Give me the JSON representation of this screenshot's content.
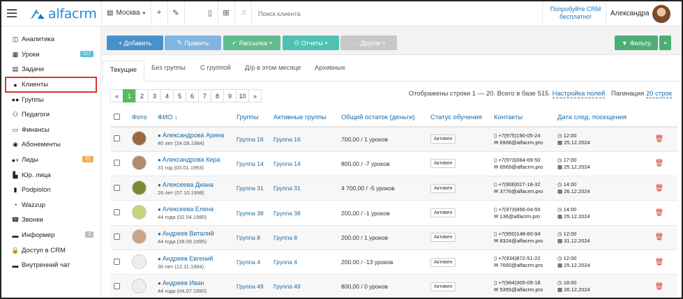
{
  "header": {
    "logo_text": "alfacrm",
    "branch": "Москва",
    "search_placeholder": "Поиск клиента",
    "try_crm": "Попробуйте CRM бесплатно!",
    "user_name": "Александра"
  },
  "sidebar": {
    "items": [
      {
        "label": "Аналитика",
        "icon": "chart-icon"
      },
      {
        "label": "Уроки",
        "icon": "calendar-icon",
        "badge": "117",
        "badge_color": "#5bc0de"
      },
      {
        "label": "Задачи",
        "icon": "clipboard-icon"
      },
      {
        "label": "Клиенты",
        "icon": "user-icon",
        "active": true
      },
      {
        "label": "Группы",
        "icon": "users-icon"
      },
      {
        "label": "Педагоги",
        "icon": "teacher-icon"
      },
      {
        "label": "Финансы",
        "icon": "money-icon"
      },
      {
        "label": "Абонементы",
        "icon": "ticket-icon"
      },
      {
        "label": "Лиды",
        "icon": "add-user-icon",
        "badge": "21",
        "badge_color": "#f0ad4e"
      },
      {
        "label": "Юр. лица",
        "icon": "building-icon"
      },
      {
        "label": "Podpislon",
        "icon": "file-icon"
      },
      {
        "label": "Wazzup",
        "icon": "chat-icon"
      },
      {
        "label": "Звонки",
        "icon": "phone-icon"
      },
      {
        "label": "Информер",
        "icon": "card-icon",
        "badge": "3",
        "badge_color": "#bbbbbb"
      },
      {
        "label": "Доступ в CRM",
        "icon": "lock-icon"
      },
      {
        "label": "Внутренний чат",
        "icon": "message-icon"
      }
    ]
  },
  "toolbar": {
    "add": "+ Добавить",
    "edit": "Править",
    "mailing": "Рассылка",
    "reports": "Отчеты",
    "other": "Другое",
    "filter": "Фильтр",
    "colors": {
      "blue": "#4a90c9",
      "blue_light": "#7fb5e0",
      "green": "#62bb8c",
      "teal": "#4fc1b2",
      "grey": "#c8c8c8",
      "filter_green": "#4cae73"
    }
  },
  "tabs": [
    "Текущие",
    "Без группы",
    "С группой",
    "Д/р в этом месяце",
    "Архивные"
  ],
  "pager": {
    "prev": "«",
    "pages": [
      "1",
      "2",
      "3",
      "4",
      "5",
      "6",
      "7",
      "8",
      "9",
      "10"
    ],
    "next": "»",
    "active": "1"
  },
  "rows_info": {
    "text": "Отображены строки 1 — 20. Всего в базе 515.",
    "fields_link": "Настройка полей",
    "pagination_label": "Пагинация",
    "pagination_value": "20 строк"
  },
  "table": {
    "columns": [
      "Фото",
      "ФИО ↓",
      "Группы",
      "Активные группы",
      "Общий остаток (деньги)",
      "Статус обучения",
      "Контакты",
      "Дата след. посещения"
    ],
    "rows": [
      {
        "name": "Александрова Арина",
        "age": "40 лет (24.08.1984)",
        "group": "Группа 16",
        "active_group": "Группа 16",
        "balance": "700,00 / 1 уроков",
        "status": "Активен",
        "phone": "+7(975)190-05-24",
        "email": "6908@alfacrm.pro",
        "time": "12:00",
        "date": "25.12.2024",
        "photo": "#9a6a3e"
      },
      {
        "name": "Александрова Кира",
        "age": "31 год (03.01.1993)",
        "group": "Группа 14",
        "active_group": "Группа 14",
        "balance": "800,00 / -7 уроков",
        "status": "Активен",
        "phone": "+7(973)084-69-50",
        "email": "6569@alfacrm.pro",
        "time": "17:00",
        "date": "25.12.2024",
        "photo": "#b58a6a"
      },
      {
        "name": "Алексеева Диана",
        "age": "26 лет (07.10.1998)",
        "group": "Группа 31",
        "active_group": "Группа 31",
        "balance": "4 700,00 / -5 уроков",
        "status": "Активен",
        "phone": "+7(906)027-18-32",
        "email": "3776@alfacrm.pro",
        "time": "14:00",
        "date": "26.12.2024",
        "photo": "#7d8a2e"
      },
      {
        "name": "Алексеева Елена",
        "age": "44 года (02.04.1980)",
        "group": "Группа 38",
        "active_group": "Группа 38",
        "balance": "200,00 / -1 уроков",
        "status": "Активен",
        "phone": "+7(973)956-04-55",
        "email": "136@alfacrm.pro",
        "time": "14:00",
        "date": "25.12.2024",
        "photo": "#c9d27a"
      },
      {
        "name": "Андреев Виталий",
        "age": "44 года (28.09.1995)",
        "group": "Группа 8",
        "active_group": "Группа 8",
        "balance": "200,00 / 1 уроков",
        "status": "Активен",
        "phone": "+7(950)148-60-94",
        "email": "8324@alfacrm.pro",
        "time": "12:00",
        "date": "31.12.2024",
        "photo": "#c9a48a"
      },
      {
        "name": "Андреев Евгений",
        "age": "30 лет (12.11.1994)",
        "group": "Группа 4",
        "active_group": "Группа 4",
        "balance": "200,00 / -13 уроков",
        "status": "Активен",
        "phone": "+7(934)872-51-22",
        "email": "7665@alfacrm.pro",
        "time": "12:00",
        "date": "25.12.2024",
        "photo": "#eeeeee"
      },
      {
        "name": "Андреев Иван",
        "age": "44 года (04.07.1980)",
        "group": "Группа 49",
        "active_group": "Группа 49",
        "balance": "800,00 / 0 уроков",
        "status": "Активен",
        "phone": "+7(964)305-09-18",
        "email": "5355@alfacrm.pro",
        "time": "18:00",
        "date": "26.12.2024",
        "photo": "#eeeeee"
      }
    ]
  }
}
